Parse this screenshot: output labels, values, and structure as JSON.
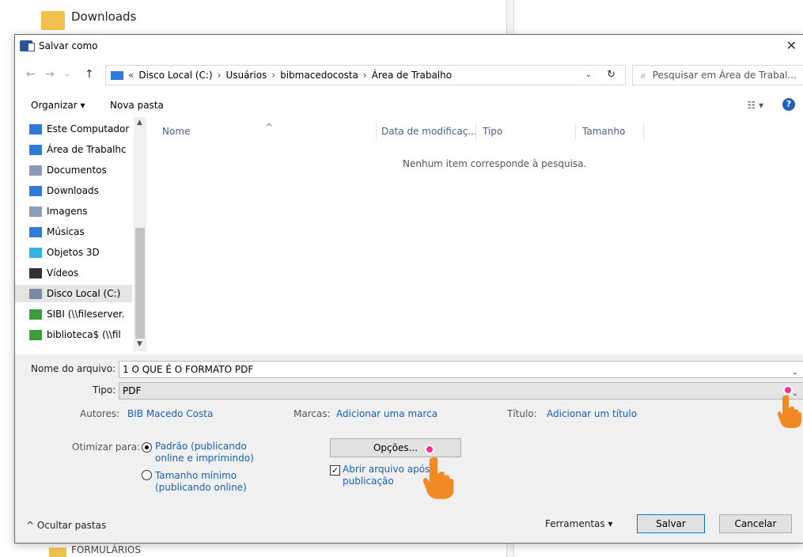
{
  "background": {
    "folder_label": "Downloads",
    "bottom_folder_label": "FORMULÁRIOS"
  },
  "dialog": {
    "title": "Salvar como",
    "close_glyph": "✕"
  },
  "address": {
    "back_glyph": "←",
    "forward_glyph": "→",
    "recent_glyph": "⌄",
    "up_glyph": "↑",
    "overflow": "«",
    "crumbs": [
      "Disco Local (C:)",
      "Usuários",
      "bibmacedocosta",
      "Área de Trabalho"
    ],
    "separator": "›",
    "dropdown_glyph": "⌄",
    "refresh_glyph": "↻",
    "search_placeholder": "Pesquisar em Área de Trabal..."
  },
  "toolbar": {
    "organize_label": "Organizar ▾",
    "new_folder_label": "Nova pasta",
    "view_label": "☷ ▾",
    "help_label": "?"
  },
  "nav": {
    "items": [
      {
        "label": "Este Computador",
        "icon": "computer-icon",
        "color": "#2f7bd7"
      },
      {
        "label": "Área de Trabalhc",
        "icon": "desktop-icon",
        "color": "#2f7bd7"
      },
      {
        "label": "Documentos",
        "icon": "documents-icon",
        "color": "#8a9bb5"
      },
      {
        "label": "Downloads",
        "icon": "downloads-icon",
        "color": "#2f7bd7"
      },
      {
        "label": "Imagens",
        "icon": "pictures-icon",
        "color": "#8aa0b8"
      },
      {
        "label": "Músicas",
        "icon": "music-icon",
        "color": "#2f7bd7"
      },
      {
        "label": "Objetos 3D",
        "icon": "3d-objects-icon",
        "color": "#37b2e6"
      },
      {
        "label": "Vídeos",
        "icon": "videos-icon",
        "color": "#333333"
      },
      {
        "label": "Disco Local (C:)",
        "icon": "drive-icon",
        "color": "#7a8aa0"
      },
      {
        "label": "SIBI (\\\\fileserver.",
        "icon": "network-drive-icon",
        "color": "#3c9c3c"
      },
      {
        "label": "biblioteca$ (\\\\fil",
        "icon": "network-drive-icon",
        "color": "#3c9c3c"
      }
    ]
  },
  "list": {
    "columns": [
      "Nome",
      "Data de modificaç...",
      "Tipo",
      "Tamanho"
    ],
    "sort_glyph": "^",
    "empty_message": "Nenhum item corresponde à pesquisa."
  },
  "form": {
    "filename_label": "Nome do arquivo:",
    "filename_value": "1 O QUE É O FORMATO PDF",
    "type_label": "Tipo:",
    "type_value": "PDF",
    "authors_label": "Autores:",
    "authors_value": "BIB Macedo Costa",
    "tags_label": "Marcas:",
    "tags_value": "Adicionar uma marca",
    "title_label": "Título:",
    "title_value": "Adicionar um título",
    "optimize_label": "Otimizar para:",
    "optimize_standard_line1": "Padrão (publicando",
    "optimize_standard_line2": "online e imprimindo)",
    "optimize_min_line1": "Tamanho mínimo",
    "optimize_min_line2": "(publicando online)",
    "options_button": "Opções...",
    "open_after_line1": "Abrir arquivo após",
    "open_after_line2": "publicação",
    "open_after_check": "✓"
  },
  "footer": {
    "hide_folders": "^  Ocultar pastas",
    "tools": "Ferramentas   ▾",
    "save": "Salvar",
    "cancel": "Cancelar"
  },
  "colors": {
    "accent": "#1a5fb4",
    "pointer": "#f08a24",
    "highlight_dot": "#ff2d8a"
  }
}
